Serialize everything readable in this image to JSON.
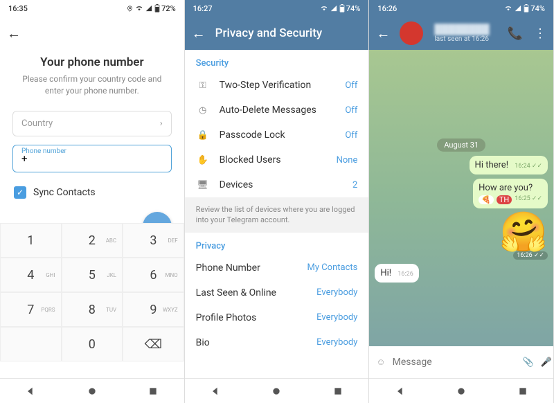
{
  "s1": {
    "status": {
      "time": "16:35",
      "battery": "72%"
    },
    "title": "Your phone number",
    "subtitle": "Please confirm your country code and enter your phone number.",
    "country_placeholder": "Country",
    "phone_label": "Phone number",
    "phone_value": "+",
    "sync_label": "Sync Contacts",
    "keypad": [
      [
        "1",
        ""
      ],
      [
        "2",
        "ABC"
      ],
      [
        "3",
        "DEF"
      ],
      [
        "4",
        "GHI"
      ],
      [
        "5",
        "JKL"
      ],
      [
        "6",
        "MNO"
      ],
      [
        "7",
        "PQRS"
      ],
      [
        "8",
        "TUV"
      ],
      [
        "9",
        "WXYZ"
      ],
      [
        "",
        "",
        ""
      ],
      [
        "0",
        ""
      ],
      [
        "⌫",
        ""
      ]
    ]
  },
  "s2": {
    "status": {
      "time": "16:27",
      "battery": "74%"
    },
    "title": "Privacy and Security",
    "security_header": "Security",
    "security": [
      {
        "label": "Two-Step Verification",
        "val": "Off"
      },
      {
        "label": "Auto-Delete Messages",
        "val": "Off"
      },
      {
        "label": "Passcode Lock",
        "val": "Off"
      },
      {
        "label": "Blocked Users",
        "val": "None"
      },
      {
        "label": "Devices",
        "val": "2"
      }
    ],
    "hint": "Review the list of devices where you are logged into your Telegram account.",
    "privacy_header": "Privacy",
    "privacy": [
      {
        "label": "Phone Number",
        "val": "My Contacts"
      },
      {
        "label": "Last Seen & Online",
        "val": "Everybody"
      },
      {
        "label": "Profile Photos",
        "val": "Everybody"
      },
      {
        "label": "Bio",
        "val": "Everybody"
      }
    ]
  },
  "s3": {
    "status": {
      "time": "16:26",
      "battery": "74%"
    },
    "contact": {
      "name": "████████",
      "sub": "last seen at 16:26"
    },
    "date": "August 31",
    "messages": {
      "m1": {
        "text": "Hi there!",
        "time": "16:24 ✓✓"
      },
      "m2": {
        "text": "How are you?",
        "time": "16:25 ✓✓",
        "r1": "🍕",
        "r2": "TH"
      },
      "m3": {
        "emoji": "🤗",
        "time": "16:26 ✓✓"
      },
      "m4": {
        "text": "Hi!",
        "time": "16:26"
      }
    },
    "input_placeholder": "Message"
  }
}
